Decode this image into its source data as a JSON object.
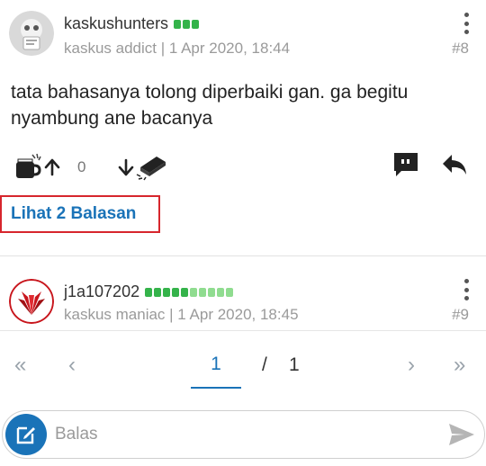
{
  "post1": {
    "username": "kaskushunters",
    "rep_bars": [
      "#34b34a",
      "#34b34a",
      "#34b34a"
    ],
    "meta": "kaskus addict | 1 Apr 2020, 18:44",
    "number": "#8",
    "content": "tata bahasanya tolong diperbaiki gan. ga begitu nyambung ane bacanya",
    "vote_count": "0",
    "view_replies": "Lihat 2 Balasan",
    "icons": [
      "cendol-icon",
      "upvote-arrow-icon",
      "downvote-arrow-icon",
      "bata-icon",
      "quote-icon",
      "reply-icon"
    ]
  },
  "post2": {
    "username": "j1a107202",
    "rep_bars": [
      "#34b34a",
      "#34b34a",
      "#34b34a",
      "#34b34a",
      "#34b34a",
      "#8fdc8f",
      "#8fdc8f",
      "#8fdc8f",
      "#8fdc8f",
      "#8fdc8f"
    ],
    "meta": "kaskus maniac | 1 Apr 2020, 18:45",
    "number": "#9"
  },
  "pagination": {
    "first": "«",
    "prev": "‹",
    "current": "1",
    "separator": "/",
    "total": "1",
    "next": "›",
    "last": "»"
  },
  "reply_bar": {
    "placeholder": "Balas"
  },
  "colors": {
    "accent": "#1a73b8",
    "highlight_border": "#d7262d",
    "rep_green": "#34b34a",
    "rep_light_green": "#8fdc8f"
  }
}
